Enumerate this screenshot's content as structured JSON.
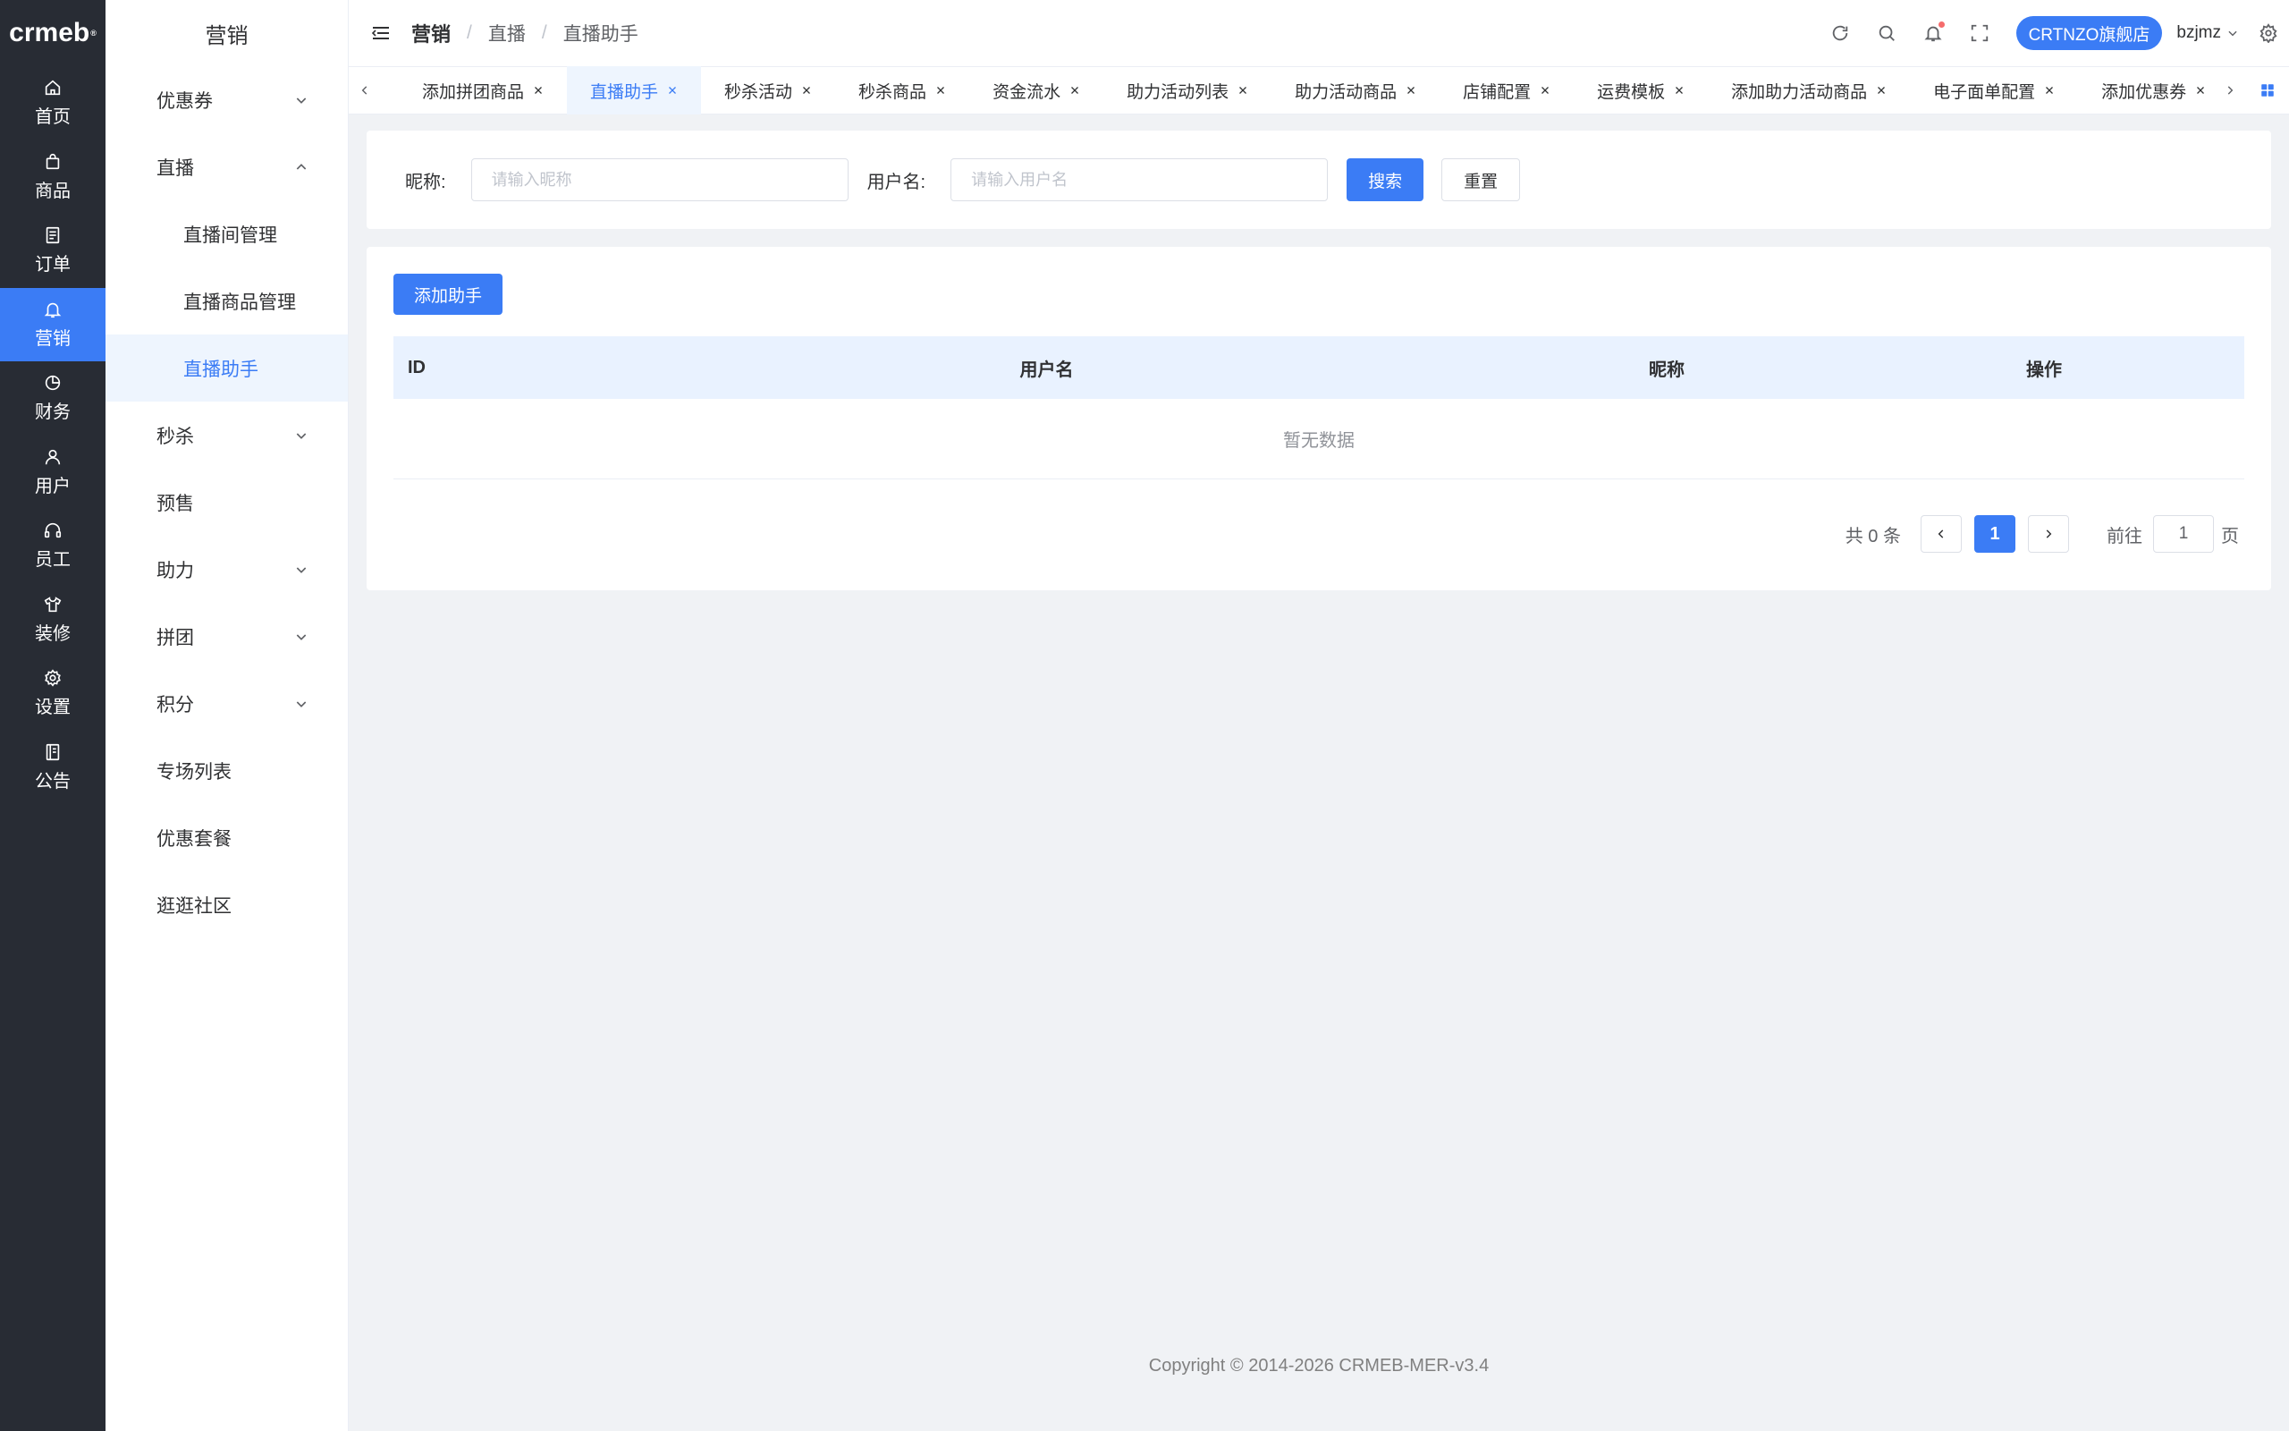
{
  "brand": {
    "logo_text": "crmeb",
    "logo_mark": "®"
  },
  "rail": [
    {
      "label": "首页",
      "icon": "home-icon",
      "active": false
    },
    {
      "label": "商品",
      "icon": "bag-icon",
      "active": false
    },
    {
      "label": "订单",
      "icon": "document-icon",
      "active": false
    },
    {
      "label": "营销",
      "icon": "bell-icon",
      "active": true
    },
    {
      "label": "财务",
      "icon": "pie-icon",
      "active": false
    },
    {
      "label": "用户",
      "icon": "user-icon",
      "active": false
    },
    {
      "label": "员工",
      "icon": "headset-icon",
      "active": false
    },
    {
      "label": "装修",
      "icon": "shirt-icon",
      "active": false
    },
    {
      "label": "设置",
      "icon": "gear-icon",
      "active": false
    },
    {
      "label": "公告",
      "icon": "notebook-icon",
      "active": false
    }
  ],
  "subnav": {
    "title": "营销",
    "items": [
      {
        "label": "优惠券",
        "arrow": "down"
      },
      {
        "label": "直播",
        "arrow": "up"
      },
      {
        "label": "直播间管理",
        "child": true
      },
      {
        "label": "直播商品管理",
        "child": true
      },
      {
        "label": "直播助手",
        "child": true,
        "active": true
      },
      {
        "label": "秒杀",
        "arrow": "down"
      },
      {
        "label": "预售"
      },
      {
        "label": "助力",
        "arrow": "down"
      },
      {
        "label": "拼团",
        "arrow": "down"
      },
      {
        "label": "积分",
        "arrow": "down"
      },
      {
        "label": "专场列表"
      },
      {
        "label": "优惠套餐"
      },
      {
        "label": "逛逛社区"
      }
    ]
  },
  "header": {
    "breadcrumb": [
      "营销",
      "直播",
      "直播助手"
    ],
    "separator": "/",
    "store_button": "CRTNZO旗舰店",
    "username": "bzjmz"
  },
  "tags": [
    {
      "label": "添加拼团商品",
      "active": false
    },
    {
      "label": "直播助手",
      "active": true
    },
    {
      "label": "秒杀活动",
      "active": false
    },
    {
      "label": "秒杀商品",
      "active": false
    },
    {
      "label": "资金流水",
      "active": false
    },
    {
      "label": "助力活动列表",
      "active": false
    },
    {
      "label": "助力活动商品",
      "active": false
    },
    {
      "label": "店铺配置",
      "active": false
    },
    {
      "label": "运费模板",
      "active": false
    },
    {
      "label": "添加助力活动商品",
      "active": false
    },
    {
      "label": "电子面单配置",
      "active": false
    },
    {
      "label": "添加优惠券",
      "active": false
    }
  ],
  "filter": {
    "nickname_label": "昵称:",
    "nickname_placeholder": "请输入昵称",
    "nickname_value": "",
    "username_label": "用户名:",
    "username_placeholder": "请输入用户名",
    "username_value": "",
    "search_label": "搜索",
    "reset_label": "重置"
  },
  "table": {
    "add_button": "添加助手",
    "columns": [
      "ID",
      "用户名",
      "昵称",
      "操作"
    ],
    "rows": [],
    "empty_text": "暂无数据"
  },
  "pagination": {
    "total_text": "共 0 条",
    "current_page": "1",
    "goto_label": "前往",
    "goto_value": "1",
    "page_unit": "页"
  },
  "footer": {
    "copyright": "Copyright © 2014-2026 CRMEB-MER-v3.4"
  },
  "colors": {
    "primary": "#3b7cf5",
    "rail_bg": "#282c34",
    "page_bg": "#f0f2f5",
    "table_head_bg": "#e9f2ff"
  }
}
